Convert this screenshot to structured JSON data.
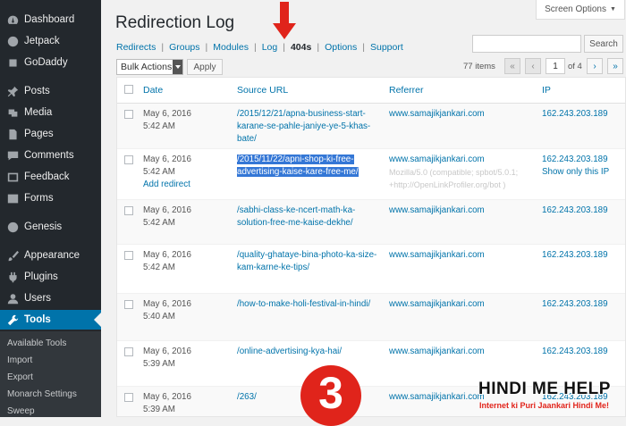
{
  "sidebar": {
    "items": [
      {
        "label": "Dashboard",
        "icon": "dashboard-icon"
      },
      {
        "label": "Jetpack",
        "icon": "jetpack-icon"
      },
      {
        "label": "GoDaddy",
        "icon": "godaddy-icon"
      },
      {
        "label": "Posts",
        "icon": "pin-icon"
      },
      {
        "label": "Media",
        "icon": "media-icon"
      },
      {
        "label": "Pages",
        "icon": "pages-icon"
      },
      {
        "label": "Comments",
        "icon": "comments-icon"
      },
      {
        "label": "Feedback",
        "icon": "feedback-icon"
      },
      {
        "label": "Forms",
        "icon": "forms-icon"
      },
      {
        "label": "Genesis",
        "icon": "genesis-icon"
      },
      {
        "label": "Appearance",
        "icon": "brush-icon"
      },
      {
        "label": "Plugins",
        "icon": "plugin-icon"
      },
      {
        "label": "Users",
        "icon": "user-icon"
      },
      {
        "label": "Tools",
        "icon": "wrench-icon"
      }
    ],
    "submenu": [
      "Available Tools",
      "Import",
      "Export",
      "Monarch Settings",
      "Sweep"
    ]
  },
  "header": {
    "title": "Redirection Log",
    "screen_options": "Screen Options",
    "subnav": [
      "Redirects",
      "Groups",
      "Modules",
      "Log",
      "404s",
      "Options",
      "Support"
    ],
    "search_button": "Search"
  },
  "toolbar": {
    "bulk_actions": "Bulk Actions",
    "apply": "Apply",
    "items": "77 items",
    "page_first": "«",
    "page_prev": "‹",
    "current_page": "1",
    "of_pages": "of 4",
    "page_next": "›",
    "page_last": "»"
  },
  "table": {
    "columns": [
      "Date",
      "Source URL",
      "Referrer",
      "IP"
    ],
    "rows": [
      {
        "date": "May 6, 2016",
        "time": "5:42 AM",
        "url": "/2015/12/21/apna-business-start-karane-se-pahle-janiye-ye-5-khas-bate/",
        "referrer": "www.samajikjankari.com",
        "ip": "162.243.203.189"
      },
      {
        "date": "May 6, 2016",
        "time": "5:42 AM",
        "action": "Add redirect",
        "url": "/2015/11/22/apni-shop-ki-free-advertising-kaise-kare-free-me/",
        "referrer": "www.samajikjankari.com",
        "user_agent": "Mozilla/5.0 (compatible; spbot/5.0.1; +http://OpenLinkProfiler.org/bot )",
        "ip": "162.243.203.189",
        "ip_action": "Show only this IP"
      },
      {
        "date": "May 6, 2016",
        "time": "5:42 AM",
        "url": "/sabhi-class-ke-ncert-math-ka-solution-free-me-kaise-dekhe/",
        "referrer": "www.samajikjankari.com",
        "ip": "162.243.203.189"
      },
      {
        "date": "May 6, 2016",
        "time": "5:42 AM",
        "url": "/quality-ghataye-bina-photo-ka-size-kam-karne-ke-tips/",
        "referrer": "www.samajikjankari.com",
        "ip": "162.243.203.189"
      },
      {
        "date": "May 6, 2016",
        "time": "5:40 AM",
        "url": "/how-to-make-holi-festival-in-hindi/",
        "referrer": "www.samajikjankari.com",
        "ip": "162.243.203.189"
      },
      {
        "date": "May 6, 2016",
        "time": "5:39 AM",
        "url": "/online-advertising-kya-hai/",
        "referrer": "www.samajikjankari.com",
        "ip": "162.243.203.189"
      },
      {
        "date": "May 6, 2016",
        "time": "5:39 AM",
        "url": "/263/",
        "referrer": "www.samajikjankari.com",
        "ip": "162.243.203.189"
      }
    ]
  },
  "overlay": {
    "step_number": "3",
    "logo_title": "HINDI ME HELP",
    "logo_tagline": "Internet ki Puri Jaankari Hindi Me!",
    "accent_color": "#e0241b"
  },
  "colors": {
    "sidebar_bg": "#23282d",
    "active_item": "#0073aa",
    "link": "#0073aa",
    "highlight": "#3477d6"
  }
}
